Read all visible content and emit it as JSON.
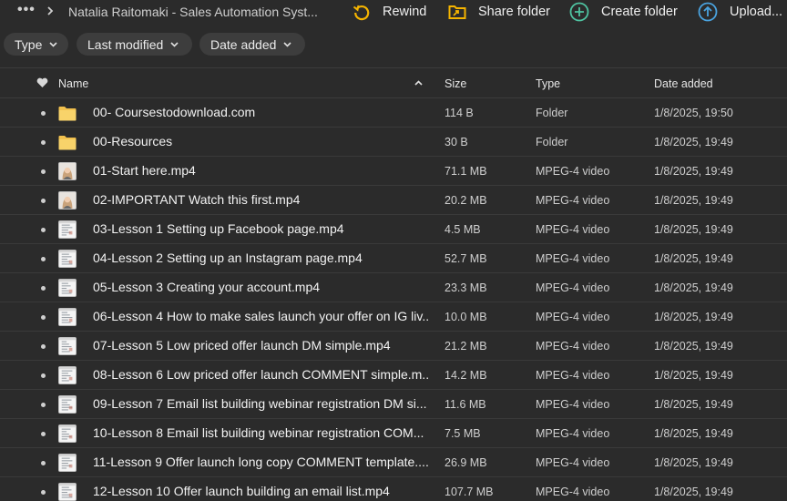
{
  "toolbar": {
    "breadcrumb": "Natalia Raitomaki - Sales Automation Syst...",
    "rewind": "Rewind",
    "share_folder": "Share folder",
    "create_folder": "Create folder",
    "upload": "Upload..."
  },
  "filters": {
    "type": "Type",
    "last_modified": "Last modified",
    "date_added": "Date added"
  },
  "columns": {
    "name": "Name",
    "size": "Size",
    "type": "Type",
    "date_added": "Date added"
  },
  "rows": [
    {
      "name": "00- Coursestodownload.com",
      "size": "114 B",
      "type": "Folder",
      "date": "1/8/2025, 19:50",
      "icon": "folder-icon"
    },
    {
      "name": "00-Resources",
      "size": "30 B",
      "type": "Folder",
      "date": "1/8/2025, 19:49",
      "icon": "folder-icon"
    },
    {
      "name": "01-Start here.mp4",
      "size": "71.1 MB",
      "type": "MPEG-4 video",
      "date": "1/8/2025, 19:49",
      "icon": "video-thumbnail-person"
    },
    {
      "name": "02-IMPORTANT Watch this first.mp4",
      "size": "20.2 MB",
      "type": "MPEG-4 video",
      "date": "1/8/2025, 19:49",
      "icon": "video-thumbnail-person"
    },
    {
      "name": "03-Lesson 1 Setting up Facebook page.mp4",
      "size": "4.5 MB",
      "type": "MPEG-4 video",
      "date": "1/8/2025, 19:49",
      "icon": "video-thumbnail-screen"
    },
    {
      "name": "04-Lesson 2 Setting up an Instagram page.mp4",
      "size": "52.7 MB",
      "type": "MPEG-4 video",
      "date": "1/8/2025, 19:49",
      "icon": "video-thumbnail-screen"
    },
    {
      "name": "05-Lesson 3 Creating your account.mp4",
      "size": "23.3 MB",
      "type": "MPEG-4 video",
      "date": "1/8/2025, 19:49",
      "icon": "video-thumbnail-screen"
    },
    {
      "name": "06-Lesson 4 How to make sales launch your offer on IG liv...",
      "size": "10.0 MB",
      "type": "MPEG-4 video",
      "date": "1/8/2025, 19:49",
      "icon": "video-thumbnail-screen"
    },
    {
      "name": "07-Lesson 5 Low priced offer launch DM simple.mp4",
      "size": "21.2 MB",
      "type": "MPEG-4 video",
      "date": "1/8/2025, 19:49",
      "icon": "video-thumbnail-screen"
    },
    {
      "name": "08-Lesson 6 Low priced offer launch COMMENT simple.m...",
      "size": "14.2 MB",
      "type": "MPEG-4 video",
      "date": "1/8/2025, 19:49",
      "icon": "video-thumbnail-screen"
    },
    {
      "name": "09-Lesson 7 Email list building webinar registration DM si...",
      "size": "11.6 MB",
      "type": "MPEG-4 video",
      "date": "1/8/2025, 19:49",
      "icon": "video-thumbnail-screen"
    },
    {
      "name": "10-Lesson 8 Email list building webinar registration COM...",
      "size": "7.5 MB",
      "type": "MPEG-4 video",
      "date": "1/8/2025, 19:49",
      "icon": "video-thumbnail-screen"
    },
    {
      "name": "11-Lesson 9 Offer launch long copy COMMENT template....",
      "size": "26.9 MB",
      "type": "MPEG-4 video",
      "date": "1/8/2025, 19:49",
      "icon": "video-thumbnail-screen"
    },
    {
      "name": "12-Lesson 10 Offer launch building an email list.mp4",
      "size": "107.7 MB",
      "type": "MPEG-4 video",
      "date": "1/8/2025, 19:49",
      "icon": "video-thumbnail-screen"
    }
  ],
  "colors": {
    "background": "#2b2b2b",
    "accent": "#f5b400",
    "create_green": "#4fc3a1",
    "upload_blue": "#4aa3df"
  }
}
